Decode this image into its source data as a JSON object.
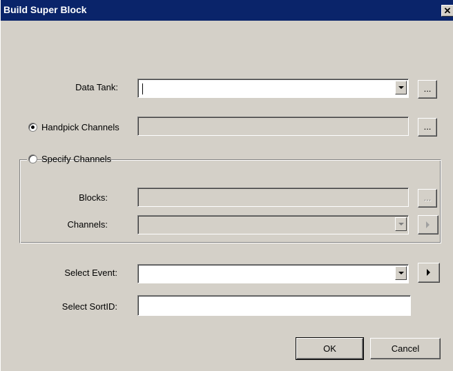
{
  "dialog": {
    "title": "Build Super Block",
    "close_glyph": "✕"
  },
  "data_tank": {
    "label": "Data Tank:",
    "value": "",
    "browse_label": "..."
  },
  "handpick": {
    "label": "Handpick Channels",
    "selected": true,
    "value": "",
    "browse_label": "..."
  },
  "specify": {
    "label": "Specify Channels",
    "selected": false,
    "blocks_label": "Blocks:",
    "blocks_value": "",
    "blocks_browse_label": "...",
    "channels_label": "Channels:",
    "channels_value": ""
  },
  "select_event": {
    "label": "Select Event:",
    "value": ""
  },
  "select_sortid": {
    "label": "Select SortID:",
    "value": ""
  },
  "buttons": {
    "ok": "OK",
    "cancel": "Cancel"
  }
}
